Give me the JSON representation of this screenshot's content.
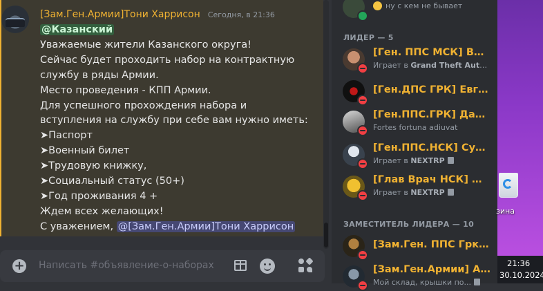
{
  "message": {
    "author": "[Зам.Ген.Армии]Тони Харрисон",
    "timestamp": "Сегодня, в 21:36",
    "mention_role": "@Казанский",
    "lines": [
      "Уважаемые жители Казанского округа!",
      "Сейчас будет проходить набор на контрактную",
      "службу в ряды Армии.",
      "Место проведения -  КПП Армии.",
      "Для успешного прохождения набора и",
      "вступления на службу при себе вам нужно иметь:",
      "➤Паспорт",
      "➤Военный билет",
      "➤Трудовую книжку,",
      "➤Социальный статус (50+)",
      "➤Год проживания 4 +",
      "Ждем всех желающих!"
    ],
    "sign_prefix": "С уважением,",
    "sign_mention": "@[Зам.Ген.Армии]Тони Харрисон"
  },
  "composer": {
    "placeholder": "Написать #объявление-о-наборах"
  },
  "members": {
    "top_status": "ну с кем не бывает",
    "sections": [
      {
        "header": "ЛИДЕР — 5",
        "items": [
          {
            "name": "[Ген. ППС МСК] Ване...",
            "status_prefix": "Играет в",
            "status_bold": "Grand Theft Auto S...",
            "status_plain": "",
            "doc": false
          },
          {
            "name": "[Ген.ДПС ГРК] Евген...",
            "status_prefix": "",
            "status_bold": "",
            "status_plain": "",
            "doc": false
          },
          {
            "name": "[Ген.ППС.ГРК] Давид...",
            "status_prefix": "",
            "status_bold": "",
            "status_plain": "Fortes fortuna adiuvat",
            "doc": false
          },
          {
            "name": "[Ген.ППС.НСК] Сулей...",
            "status_prefix": "Играет в",
            "status_bold": "NEXTRP",
            "status_plain": "",
            "doc": true
          },
          {
            "name": "[Глав Врач НСК] Д. С...",
            "status_prefix": "Играет в",
            "status_bold": "NEXTRP",
            "status_plain": "",
            "doc": true
          }
        ]
      },
      {
        "header": "ЗАМЕСТИТЕЛЬ ЛИДЕРА — 10",
        "items": [
          {
            "name": "[Зам.Ген. ППС Грк]Ег...",
            "status_prefix": "",
            "status_bold": "",
            "status_plain": "",
            "doc": false
          },
          {
            "name": "[Зам.Ген.Армии] Аму...",
            "status_prefix": "",
            "status_bold": "",
            "status_plain": "Мой склад, крышки по...",
            "doc": true
          }
        ]
      }
    ]
  },
  "desktop": {
    "bin_label": "зина",
    "time": "21:36",
    "date": "30.10.2024"
  },
  "colors": {
    "accent_gold": "#f0b232",
    "highlight_bg": "#3d3a30",
    "dnd_red": "#f23f43",
    "online_green": "#23a559"
  }
}
